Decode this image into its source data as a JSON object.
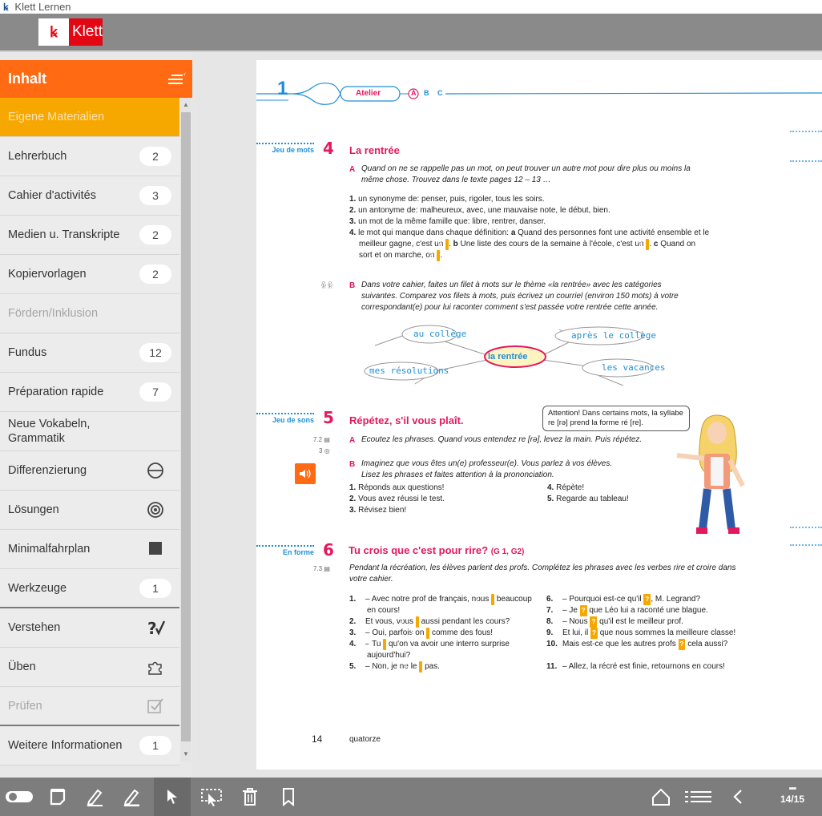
{
  "window": {
    "title": "Klett Lernen"
  },
  "header": {
    "logo_text": "Klett",
    "logo_mark": "ꝃ"
  },
  "sidebar": {
    "title": "Inhalt",
    "items": [
      {
        "label": "Eigene Materialien",
        "state": "active"
      },
      {
        "label": "Lehrerbuch",
        "badge": "2"
      },
      {
        "label": "Cahier d'activités",
        "badge": "3"
      },
      {
        "label": "Medien u. Transkripte",
        "badge": "2"
      },
      {
        "label": "Kopiervorlagen",
        "badge": "2"
      },
      {
        "label": "Fördern/Inklusion",
        "state": "disabled"
      },
      {
        "label": "Fundus",
        "badge": "12"
      },
      {
        "label": "Préparation rapide",
        "badge": "7"
      },
      {
        "label": "Neue Vokabeln, Grammatik"
      },
      {
        "label": "Differenzierung",
        "icon": "minus-circle-icon"
      },
      {
        "label": "Lösungen",
        "icon": "target-icon"
      },
      {
        "label": "Minimalfahrplan",
        "icon": "square-icon"
      },
      {
        "label": "Werkzeuge",
        "badge": "1"
      },
      {
        "label": "Verstehen",
        "icon": "question-check-icon"
      },
      {
        "label": "Üben",
        "icon": "puzzle-icon"
      },
      {
        "label": "Prüfen",
        "icon": "checkbox-icon",
        "state": "disabled"
      },
      {
        "label": "Weitere Informationen",
        "badge": "1"
      }
    ]
  },
  "page": {
    "unit_no": "1",
    "unit_tabs": [
      "Atelier",
      "A",
      "B",
      "C"
    ],
    "ex4": {
      "side": "Jeu de mots",
      "no": "4",
      "title": "La rentrée",
      "A_label": "A",
      "A_text": "Quand on ne se rappelle pas un mot, on peut trouver un autre mot pour dire plus ou moins la même chose. Trouvez dans le texte pages 12 – 13 …",
      "items": [
        {
          "n": "1.",
          "t": "un synonyme de: penser, puis, rigoler, tous les soirs."
        },
        {
          "n": "2.",
          "t": "un antonyme de: malheureux, avec, une mauvaise note, le début, bien."
        },
        {
          "n": "3.",
          "t": "un mot de la même famille que: libre, rentrer, danser."
        }
      ],
      "item4_n": "4.",
      "item4_a": "le mot qui manque dans chaque définition:",
      "item4_b": "Quand des personnes font une activité ensemble et le meilleur gagne, c'est un",
      "item4_c": "Une liste des cours de la semaine à l'école, c'est un",
      "item4_d": "Quand on sort et on marche, on",
      "B_label": "B",
      "B_text": "Dans votre cahier, faites un filet à mots sur le thème «la rentrée» avec les catégories suivantes. Comparez vos filets à mots, puis écrivez un courriel (environ 150 mots) à votre correspondant(e) pour lui raconter comment s'est passée votre rentrée cette année.",
      "mind_center": "la rentrée",
      "mind_nodes": [
        "au collège",
        "après le collège",
        "mes résolutions",
        "les vacances"
      ]
    },
    "ex5": {
      "side": "Jeu de sons",
      "no": "5",
      "title": "Répétez, s'il vous plaît.",
      "ref1": "7.2",
      "ref2": "3",
      "A_label": "A",
      "A_text": "Ecoutez les phrases. Quand vous entendez re [rə], levez la main. Puis répétez.",
      "B_label": "B",
      "B_text": "Imaginez que vous êtes un(e) professeur(e). Vous parlez à vos élèves. Lisez les phrases et faites attention à la prononciation.",
      "items_left": [
        {
          "n": "1.",
          "t": "Réponds aux questions!"
        },
        {
          "n": "2.",
          "t": "Vous avez réussi le test."
        },
        {
          "n": "3.",
          "t": "Révisez bien!"
        }
      ],
      "items_right": [
        {
          "n": "4.",
          "t": "Répète!"
        },
        {
          "n": "5.",
          "t": "Regarde au tableau!"
        }
      ],
      "bubble": "Attention! Dans certains mots, la syllabe re [rə] prend la forme ré [re]."
    },
    "ex6": {
      "side": "En forme",
      "no": "6",
      "title": "Tu crois que c'est pour rire?",
      "gram": "(G 1, G2)",
      "ref": "7.3",
      "intro": "Pendant la récréation, les élèves parlent des profs. Complétez les phrases avec les verbes rire et croire dans votre cahier.",
      "left": [
        {
          "n": "1.",
          "a": "– Avec notre prof de français, nous",
          "b": "beaucoup en cours!"
        },
        {
          "n": "2.",
          "a": "Et vous, vous",
          "b": "aussi pendant les cours?"
        },
        {
          "n": "3.",
          "a": "– Oui, parfois on",
          "b": "comme des fous!"
        },
        {
          "n": "4.",
          "a": "– Tu",
          "b": "qu'on va avoir une interro surprise aujourd'hui?"
        },
        {
          "n": "5.",
          "a": "– Non, je ne le",
          "b": "pas."
        }
      ],
      "right": [
        {
          "n": "6.",
          "a": "– Pourquoi est-ce qu'il",
          "b": ", M. Legrand?"
        },
        {
          "n": "7.",
          "a": "– Je",
          "b": "que Léo lui a raconté une blague."
        },
        {
          "n": "8.",
          "a": "– Nous",
          "b": "qu'il est le meilleur prof."
        },
        {
          "n": "9.",
          "a": "Et lui, il",
          "b": "que nous sommes la meilleure classe!"
        },
        {
          "n": "10.",
          "a": "Mais est-ce que les autres profs",
          "b": "cela aussi?"
        },
        {
          "n": "11.",
          "a": "– Allez, la récré est finie, retournons en cours!",
          "b": ""
        }
      ]
    },
    "footer": {
      "page_no": "14",
      "page_word": "quatorze"
    },
    "placeholder": "?"
  },
  "toolbar": {
    "tools": [
      "toggle-icon",
      "bookmark-tab-icon",
      "pencil-icon",
      "highlighter-icon",
      "pointer-icon",
      "select-area-icon",
      "trash-icon",
      "bookmark-icon"
    ],
    "pager": "14/15",
    "pager_grid": "▪▪▪"
  },
  "colors": {
    "accent": "#ff6a13",
    "active": "#f7a800",
    "brand": "#e30613",
    "pink": "#e2195f",
    "blue": "#1e8fd6"
  }
}
